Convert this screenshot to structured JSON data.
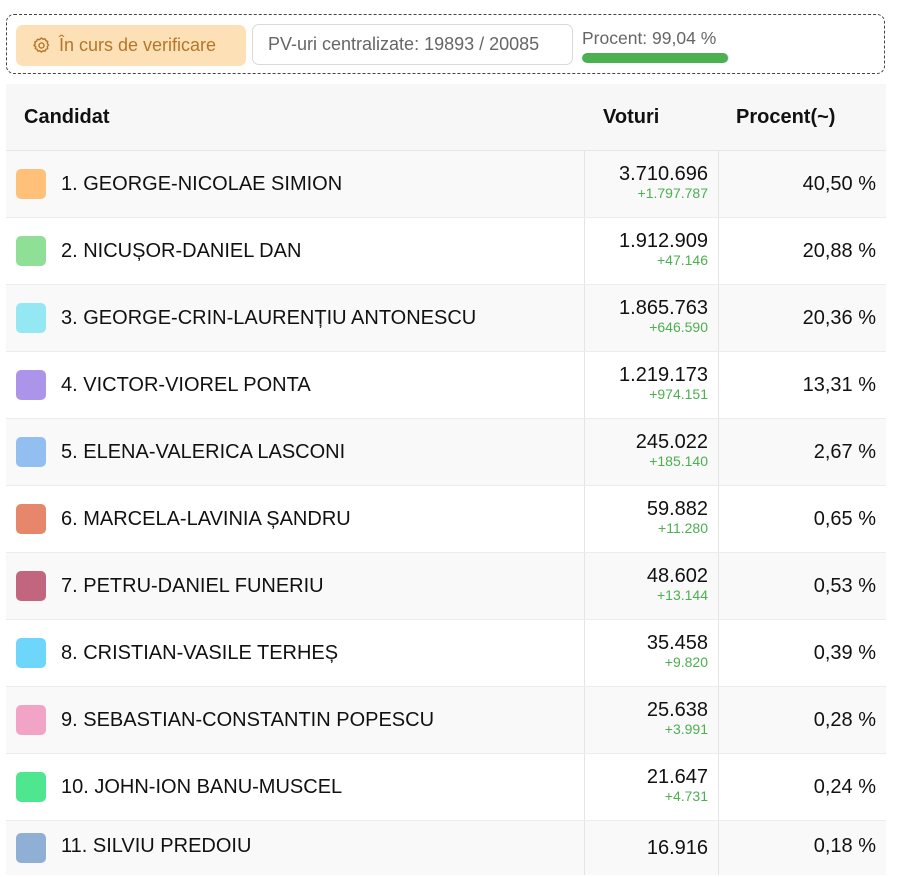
{
  "status": {
    "badge_label": "În curs de verificare",
    "pv_label": "PV-uri centralizate: 19893 / 20085",
    "percent_label": "Procent: 99,04 %",
    "percent_value": 99.04
  },
  "table": {
    "headers": {
      "candidate": "Candidat",
      "votes": "Voturi",
      "percent": "Procent(~)"
    },
    "rows": [
      {
        "name": "1. GEORGE-NICOLAE SIMION",
        "votes": "3.710.696",
        "delta": "+1.797.787",
        "percent": "40,50 %",
        "color": "#ffc07a"
      },
      {
        "name": "2. NICUȘOR-DANIEL DAN",
        "votes": "1.912.909",
        "delta": "+47.146",
        "percent": "20,88 %",
        "color": "#8fdf96"
      },
      {
        "name": "3. GEORGE-CRIN-LAURENȚIU ANTONESCU",
        "votes": "1.865.763",
        "delta": "+646.590",
        "percent": "20,36 %",
        "color": "#93e8f4"
      },
      {
        "name": "4. VICTOR-VIOREL PONTA",
        "votes": "1.219.173",
        "delta": "+974.151",
        "percent": "13,31 %",
        "color": "#ab94ea"
      },
      {
        "name": "5. ELENA-VALERICA LASCONI",
        "votes": "245.022",
        "delta": "+185.140",
        "percent": "2,67 %",
        "color": "#92bef0"
      },
      {
        "name": "6. MARCELA-LAVINIA ȘANDRU",
        "votes": "59.882",
        "delta": "+11.280",
        "percent": "0,65 %",
        "color": "#e6866b"
      },
      {
        "name": "7. PETRU-DANIEL FUNERIU",
        "votes": "48.602",
        "delta": "+13.144",
        "percent": "0,53 %",
        "color": "#c2657f"
      },
      {
        "name": "8. CRISTIAN-VASILE TERHEȘ",
        "votes": "35.458",
        "delta": "+9.820",
        "percent": "0,39 %",
        "color": "#6fd6fb"
      },
      {
        "name": "9. SEBASTIAN-CONSTANTIN POPESCU",
        "votes": "25.638",
        "delta": "+3.991",
        "percent": "0,28 %",
        "color": "#f2a4c7"
      },
      {
        "name": "10. JOHN-ION BANU-MUSCEL",
        "votes": "21.647",
        "delta": "+4.731",
        "percent": "0,24 %",
        "color": "#4fe690"
      },
      {
        "name": "11. SILVIU PREDOIU",
        "votes": "16.916",
        "delta": "",
        "percent": "0,18 %",
        "color": "#8fb0d4"
      }
    ]
  }
}
